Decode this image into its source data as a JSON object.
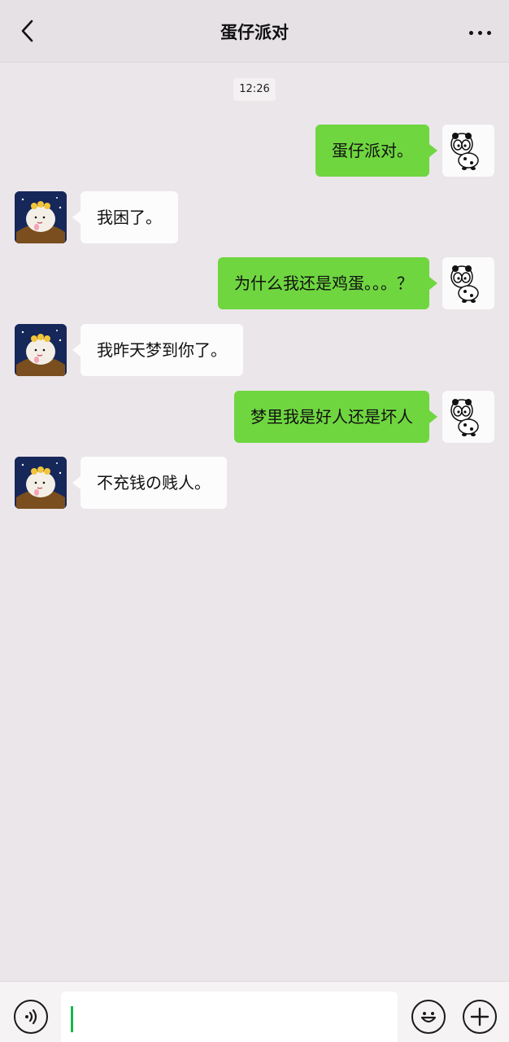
{
  "header": {
    "title": "蛋仔派对",
    "back_icon": "chevron-left-icon",
    "more_icon": "more-horizontal-icon"
  },
  "chat": {
    "timestamp": "12:26",
    "messages": [
      {
        "side": "sent",
        "text": "蛋仔派对。"
      },
      {
        "side": "received",
        "text": "我困了。"
      },
      {
        "side": "sent",
        "text": "为什么我还是鸡蛋。。。？"
      },
      {
        "side": "received",
        "text": "我昨天梦到你了。"
      },
      {
        "side": "sent",
        "text": "梦里我是好人还是坏人"
      },
      {
        "side": "received",
        "text": "不充钱の贱人。"
      }
    ]
  },
  "input_bar": {
    "value": "",
    "voice_icon": "voice-icon",
    "emoji_icon": "emoji-icon",
    "plus_icon": "plus-icon"
  },
  "colors": {
    "sent_bubble": "#6fd640",
    "received_bubble": "#fdfcfd",
    "background": "#ebe6e9",
    "caret": "#17b84a"
  }
}
